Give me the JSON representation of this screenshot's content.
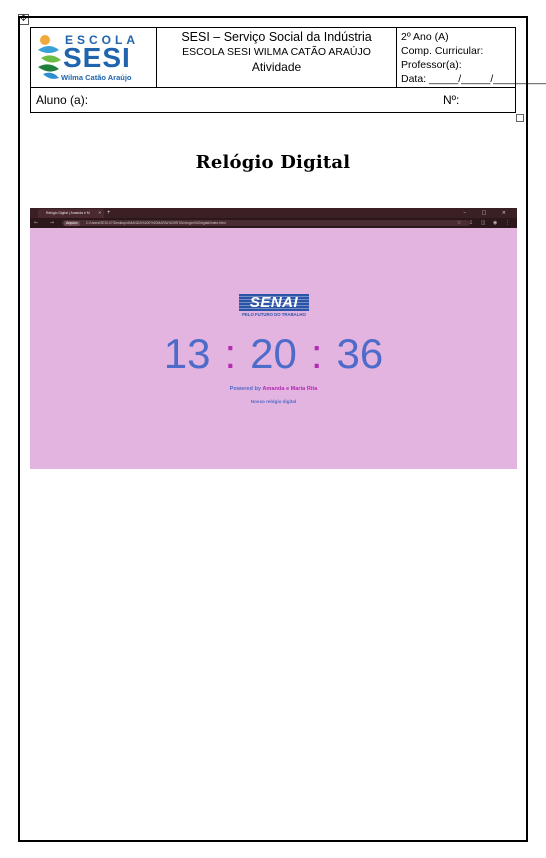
{
  "header": {
    "school_logo": {
      "escola": "ESCOLA",
      "sesi": "SESI",
      "subtitle": "Wilma Catão Araújo"
    },
    "title_line1": "SESI – Serviço Social da Indústria",
    "title_line2": "ESCOLA SESI WILMA CATÃO ARAÚJO",
    "title_line3": "Atividade",
    "grade": "2º Ano (A)",
    "curricular": "Comp. Curricular:",
    "teacher": "Professor(a):",
    "date": "Data: _____/_____/_________",
    "student_label": "Aluno (a):",
    "number_label": "Nº:"
  },
  "document_title": "Relógio Digital",
  "screenshot": {
    "tab_title": "Relógio Digital | Amanda e M",
    "tab_close": "×",
    "new_tab": "+",
    "window_controls": "– □ ×",
    "nav_icons": "← → ⟳",
    "address_chip": "Arquivo",
    "address_url": "C:/Users/SESI-07/Desktop/AMANDA%20E%20MARIA%20RITA/relogio%20digital/index.html",
    "toolbar_icons": "☆ ⇩ ◫ ◉ ⋮",
    "senai_text": "SENAI",
    "senai_tagline": "PELO FUTURO DO TRABALHO",
    "clock": {
      "hours": "13",
      "minutes": "20",
      "seconds": "36",
      "separator": ":"
    },
    "powered_prefix": "Powered by",
    "powered_names": "Amanda e Maria Rita",
    "caption": "Nosso relógio digital"
  },
  "colors": {
    "page_background": "#e4b4e0",
    "clock_digits": "#4d6bc9",
    "clock_separator": "#b22ab5",
    "senai_blue": "#2b53a8",
    "sesi_blue": "#1f64ad"
  }
}
